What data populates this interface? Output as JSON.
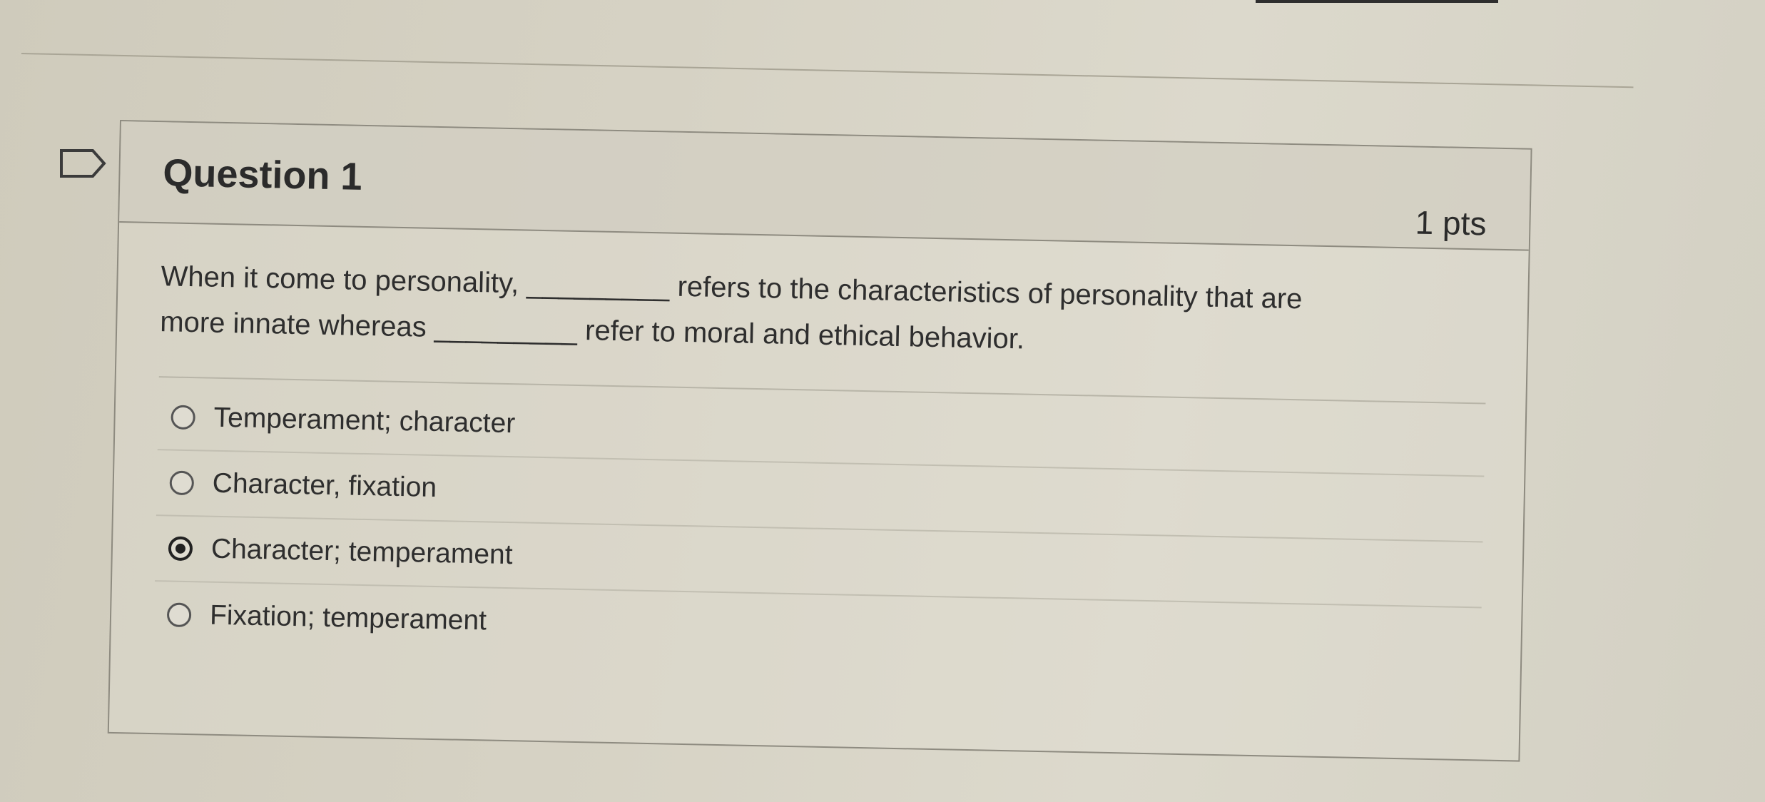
{
  "question": {
    "title": "Question 1",
    "points": "1 pts",
    "text_line1": "When it come to personality, _________ refers to the characteristics of personality that are",
    "text_line2": "more innate whereas _________ refer to moral and ethical behavior."
  },
  "answers": [
    {
      "label": "Temperament; character",
      "selected": false
    },
    {
      "label": "Character, fixation",
      "selected": false
    },
    {
      "label": "Character; temperament",
      "selected": true
    },
    {
      "label": "Fixation; temperament",
      "selected": false
    }
  ],
  "icons": {
    "flag": "flag-outline-icon"
  }
}
